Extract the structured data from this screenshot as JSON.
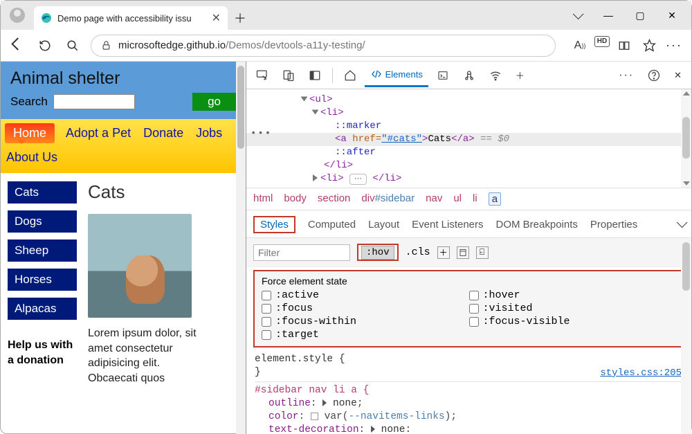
{
  "browser": {
    "tab_title": "Demo page with accessibility issu",
    "address_host": "microsoftedge.github.io",
    "address_path": "/Demos/devtools-a11y-testing/"
  },
  "page": {
    "title": "Animal shelter",
    "search_label": "Search",
    "go_label": "go",
    "nav": {
      "home": "Home",
      "adopt": "Adopt a Pet",
      "donate": "Donate",
      "jobs": "Jobs",
      "about": "About Us"
    },
    "sidebar_items": [
      "Cats",
      "Dogs",
      "Sheep",
      "Horses",
      "Alpacas"
    ],
    "heading": "Cats",
    "lorem": "Lorem ipsum dolor, sit amet consectetur adipisicing elit. Obcaecati quos",
    "help_text": "Help us with a donation"
  },
  "devtools": {
    "tabs": {
      "elements": "Elements"
    },
    "dom": {
      "l1": "<ul>",
      "l2": "<li>",
      "l3": "::marker",
      "l4_open": "<a ",
      "l4_attr": "href=",
      "l4_val": "\"#cats\"",
      "l4_mid": ">",
      "l4_txt": "Cats",
      "l4_close": "</a>",
      "l4_tail": " == $0",
      "l5": "::after",
      "l6": "</li>",
      "l7a": "<li>",
      "l7b": "</li>"
    },
    "crumbs": [
      "html",
      "body",
      "section",
      "div#sidebar",
      "nav",
      "ul",
      "li",
      "a"
    ],
    "subtabs": [
      "Styles",
      "Computed",
      "Layout",
      "Event Listeners",
      "DOM Breakpoints",
      "Properties"
    ],
    "filter_placeholder": "Filter",
    "hov_label": ":hov",
    "cls_label": ".cls",
    "states_title": "Force element state",
    "states": {
      "active": ":active",
      "hover": ":hover",
      "focus": ":focus",
      "visited": ":visited",
      "focus_within": ":focus-within",
      "focus_visible": ":focus-visible",
      "target": ":target"
    },
    "rules": {
      "es_open": "element.style {",
      "es_close": "}",
      "sel": "#sidebar nav li a {",
      "p1_k": "outline",
      "p1_v": "none",
      "p2_k": "color",
      "p2_var": "--navitems-links",
      "p3_k": "text-decoration",
      "p3_v": "none",
      "src": "styles.css:205"
    }
  }
}
